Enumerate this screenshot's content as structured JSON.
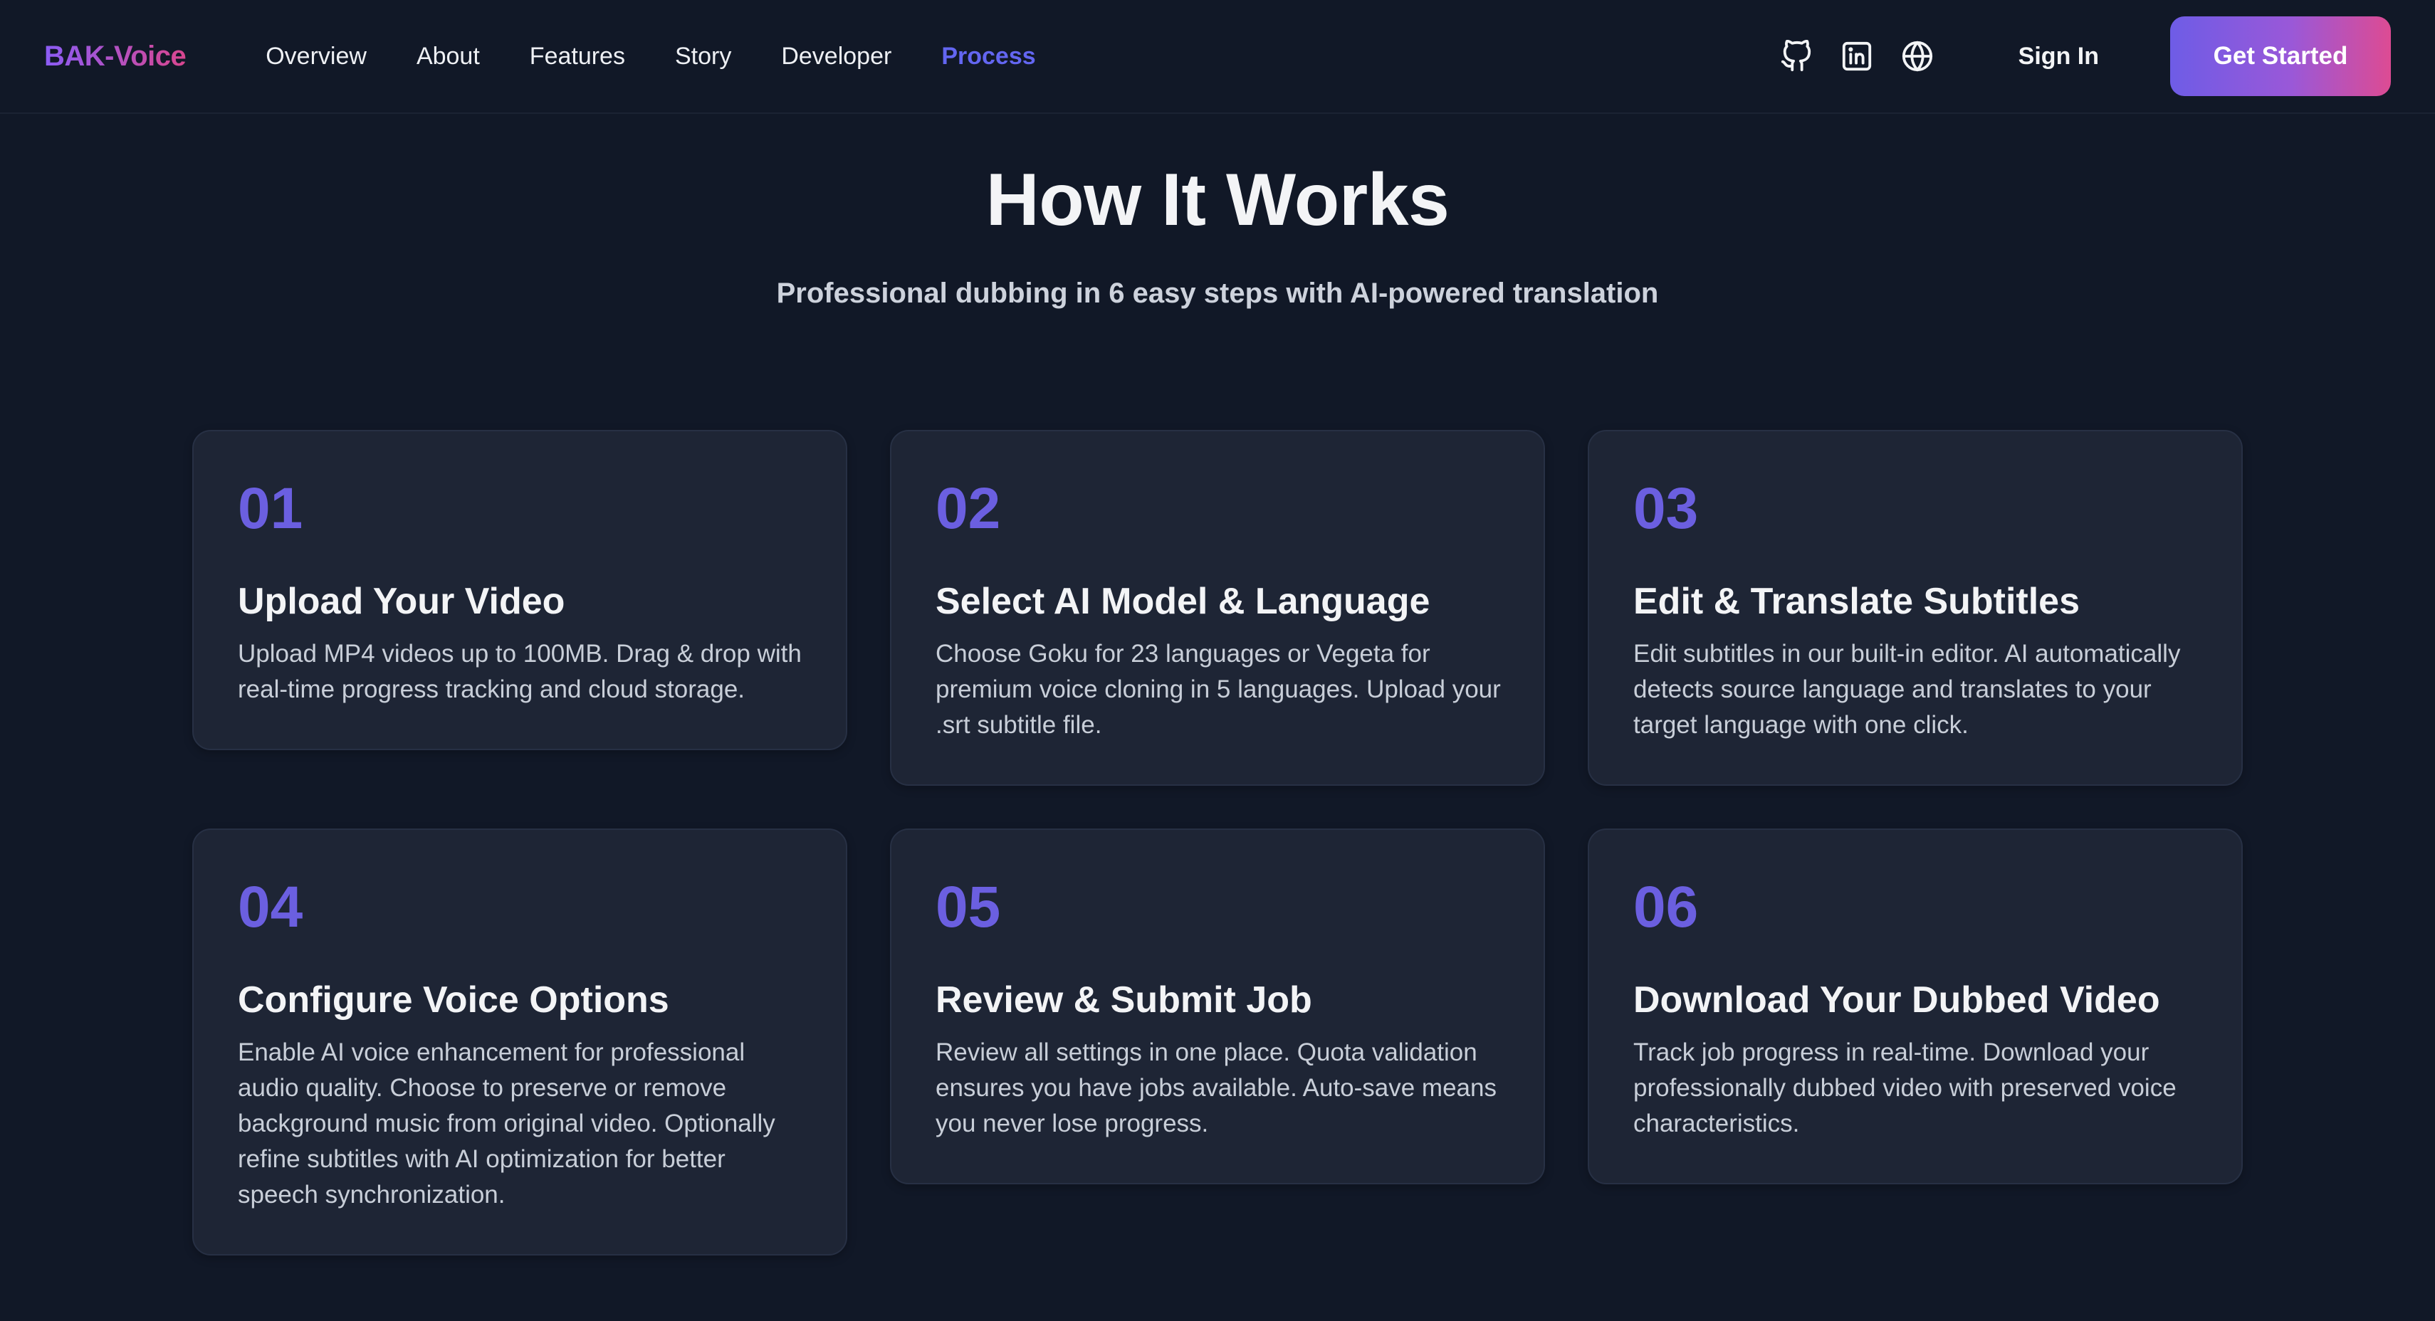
{
  "nav": {
    "brand": "BAK-Voice",
    "links": [
      {
        "label": "Overview",
        "active": false
      },
      {
        "label": "About",
        "active": false
      },
      {
        "label": "Features",
        "active": false
      },
      {
        "label": "Story",
        "active": false
      },
      {
        "label": "Developer",
        "active": false
      },
      {
        "label": "Process",
        "active": true
      }
    ],
    "icons": [
      "github-icon",
      "linkedin-icon",
      "globe-icon"
    ],
    "sign_in": "Sign In",
    "get_started": "Get Started"
  },
  "hero": {
    "title": "How It Works",
    "subtitle": "Professional dubbing in 6 easy steps with AI-powered translation"
  },
  "steps": [
    {
      "number": "01",
      "title": "Upload Your Video",
      "description": "Upload MP4 videos up to 100MB. Drag & drop with real-time progress tracking and cloud storage."
    },
    {
      "number": "02",
      "title": "Select AI Model & Language",
      "description": "Choose Goku for 23 languages or Vegeta for premium voice cloning in 5 languages. Upload your .srt subtitle file."
    },
    {
      "number": "03",
      "title": "Edit & Translate Subtitles",
      "description": "Edit subtitles in our built-in editor. AI automatically detects source language and translates to your target language with one click."
    },
    {
      "number": "04",
      "title": "Configure Voice Options",
      "description": "Enable AI voice enhancement for professional audio quality. Choose to preserve or remove background music from original video. Optionally refine subtitles with AI optimization for better speech synchronization."
    },
    {
      "number": "05",
      "title": "Review & Submit Job",
      "description": "Review all settings in one place. Quota validation ensures you have jobs available. Auto-save means you never lose progress."
    },
    {
      "number": "06",
      "title": "Download Your Dubbed Video",
      "description": "Track job progress in real-time. Download your professionally dubbed video with preserved voice characteristics."
    }
  ],
  "colors": {
    "background": "#111827",
    "card": "#1e2535",
    "accent": "#6b5fe0",
    "active_link": "#6366f1",
    "cta_gradient_start": "#6e5ce6",
    "cta_gradient_end": "#dd4b93"
  }
}
